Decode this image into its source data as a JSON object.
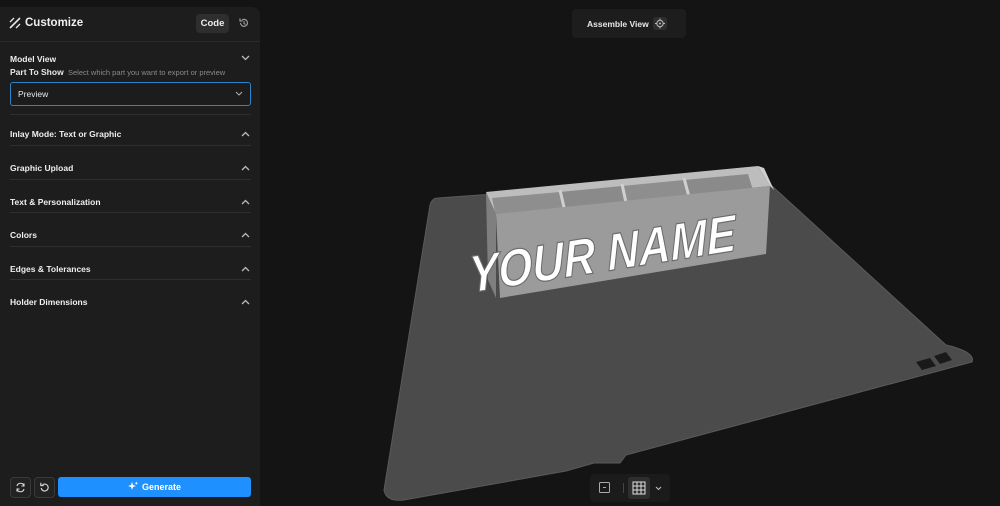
{
  "sidebar": {
    "title": "Customize",
    "code_label": "Code",
    "model_view": {
      "title": "Model View",
      "part_label": "Part To Show",
      "part_hint": "Select which part you want to export or preview",
      "selected": "Preview"
    },
    "sections": [
      {
        "title": "Inlay Mode: Text or Graphic"
      },
      {
        "title": "Graphic Upload"
      },
      {
        "title": "Text & Personalization"
      },
      {
        "title": "Colors"
      },
      {
        "title": "Edges & Tolerances"
      },
      {
        "title": "Holder Dimensions"
      }
    ],
    "generate_label": "Generate"
  },
  "viewport": {
    "assemble_label": "Assemble View",
    "model_text": "YOUR NAME"
  },
  "colors": {
    "accent": "#1e90ff",
    "background": "#141414",
    "panel": "#1d1d1d",
    "plate": "#4a4a4a"
  }
}
